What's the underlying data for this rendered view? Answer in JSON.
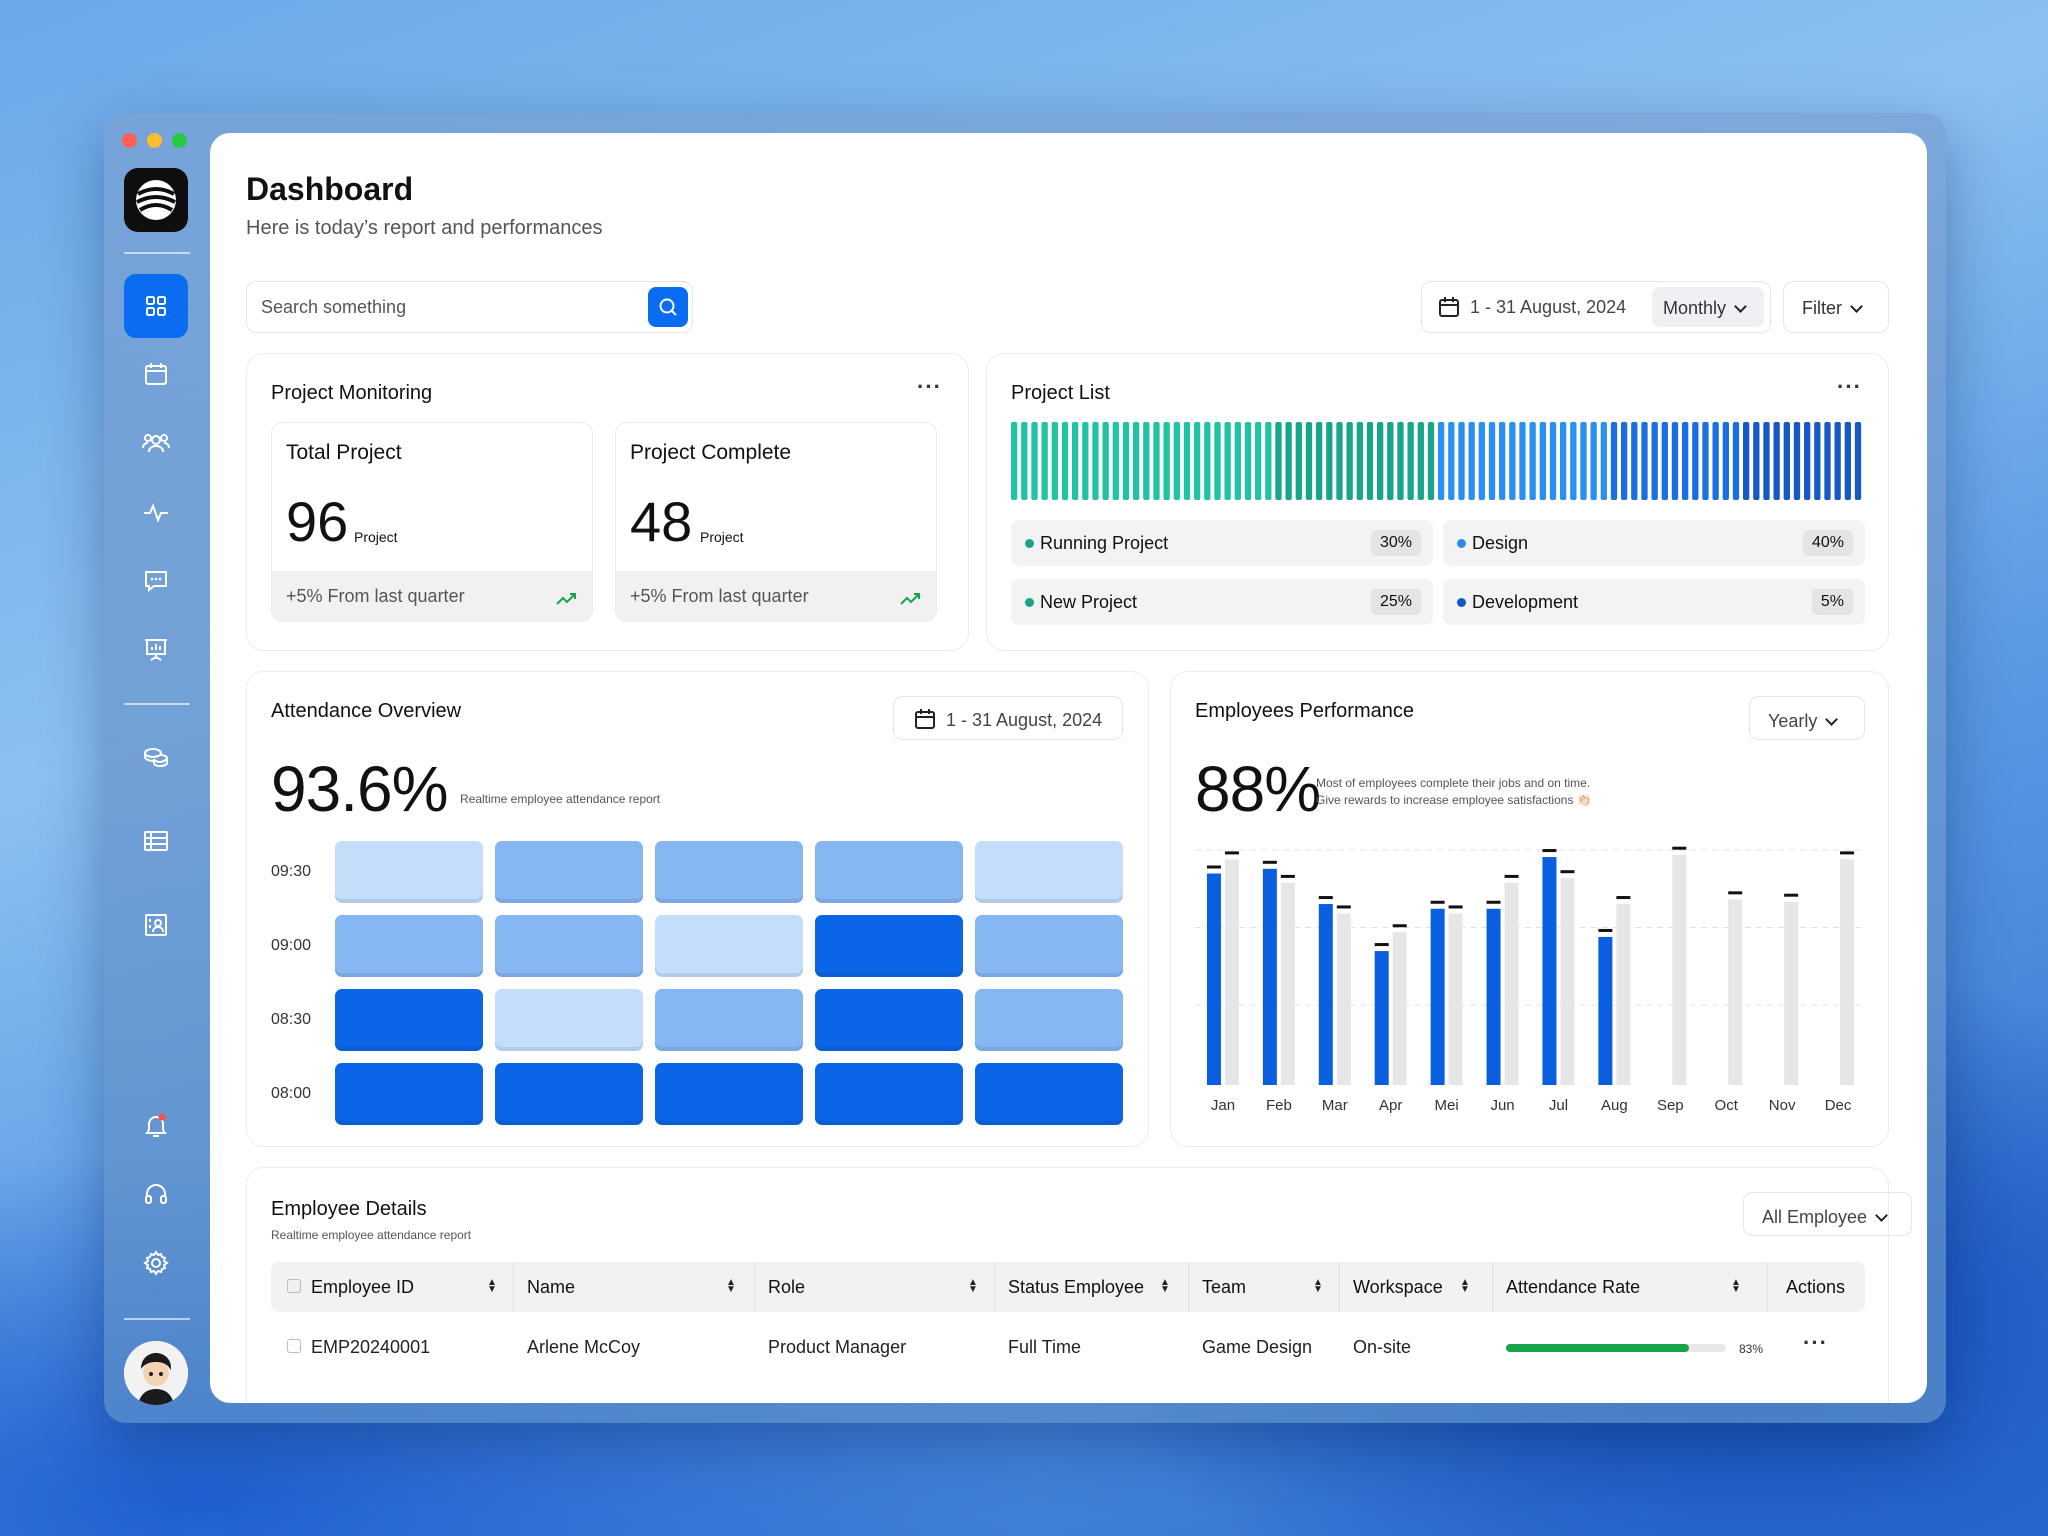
{
  "window_controls": {
    "colors": [
      "#ff5f57",
      "#febc2e",
      "#28c840"
    ]
  },
  "sidebar": {
    "items": [
      {
        "icon": "grid-icon",
        "active": true
      },
      {
        "icon": "calendar-icon"
      },
      {
        "icon": "users-icon"
      },
      {
        "icon": "activity-icon"
      },
      {
        "icon": "chat-icon"
      },
      {
        "icon": "presentation-icon"
      },
      {
        "icon": "coins-icon"
      },
      {
        "icon": "list-icon"
      },
      {
        "icon": "contact-card-icon"
      }
    ],
    "bottom": [
      {
        "icon": "bell-icon"
      },
      {
        "icon": "headset-icon"
      },
      {
        "icon": "gear-icon"
      }
    ]
  },
  "header": {
    "title": "Dashboard",
    "subtitle": "Here is today’s report and performances"
  },
  "search": {
    "placeholder": "Search something"
  },
  "toolbar": {
    "date_range": "1 - 31 August,  2024",
    "period": "Monthly",
    "filter": "Filter"
  },
  "project_monitoring": {
    "title": "Project Monitoring",
    "total": {
      "label": "Total Project",
      "value": "96",
      "unit": "Project",
      "footer": "+5% From last quarter"
    },
    "complete": {
      "label": "Project Complete",
      "value": "48",
      "unit": "Project",
      "footer": "+5% From last quarter"
    }
  },
  "project_list": {
    "title": "Project List",
    "items": [
      {
        "label": "Running Project",
        "pct": "30%",
        "color": "#15a38a"
      },
      {
        "label": "Design",
        "pct": "40%",
        "color": "#2b8cf0"
      },
      {
        "label": "New Project",
        "pct": "25%",
        "color": "#15a38a"
      },
      {
        "label": "Development",
        "pct": "5%",
        "color": "#1456c4"
      }
    ]
  },
  "attendance": {
    "title": "Attendance Overview",
    "date_range": "1 - 31 August,  2024",
    "value": "93.6%",
    "note": "Realtime employee attendance report",
    "times": [
      "09:30",
      "09:00",
      "08:30",
      "08:00"
    ],
    "grid": [
      [
        1,
        2,
        2,
        2,
        1
      ],
      [
        2,
        2,
        1,
        4,
        2
      ],
      [
        4,
        1,
        2,
        4,
        2
      ],
      [
        4,
        4,
        4,
        4,
        4
      ]
    ]
  },
  "performance": {
    "title": "Employees Performance",
    "period": "Yearly",
    "value": "88%",
    "note_line1": "Most of employees complete their jobs and on time.",
    "note_line2": "Give rewards to increase employee satisfactions 👏🏻"
  },
  "chart_data": {
    "type": "bar",
    "categories": [
      "Jan",
      "Feb",
      "Mar",
      "Apr",
      "Mei",
      "Jun",
      "Jul",
      "Aug",
      "Sep",
      "Oct",
      "Nov",
      "Dec"
    ],
    "series": [
      {
        "values": [
          90,
          92,
          77,
          57,
          75,
          75,
          97,
          63,
          null,
          null,
          null,
          null
        ],
        "color": "#0a5fe0"
      },
      {
        "values": [
          96,
          86,
          73,
          65,
          73,
          86,
          88,
          77,
          98,
          79,
          78,
          96
        ],
        "color": "#e6e6e6"
      }
    ],
    "ylim": [
      0,
      100
    ],
    "grid": true
  },
  "employee_details": {
    "title": "Employee Details",
    "subtitle": "Realtime employee attendance report",
    "filter": "All Employee",
    "columns": [
      "Employee ID",
      "Name",
      "Role",
      "Status Employee",
      "Team",
      "Workspace",
      "Attendance Rate",
      "Actions"
    ],
    "rows": [
      {
        "id": "EMP20240001",
        "name": "Arlene McCoy",
        "role": "Product Manager",
        "status": "Full Time",
        "team": "Game Design",
        "workspace": "On-site",
        "rate": "83%",
        "rate_value": 0.83
      }
    ]
  }
}
